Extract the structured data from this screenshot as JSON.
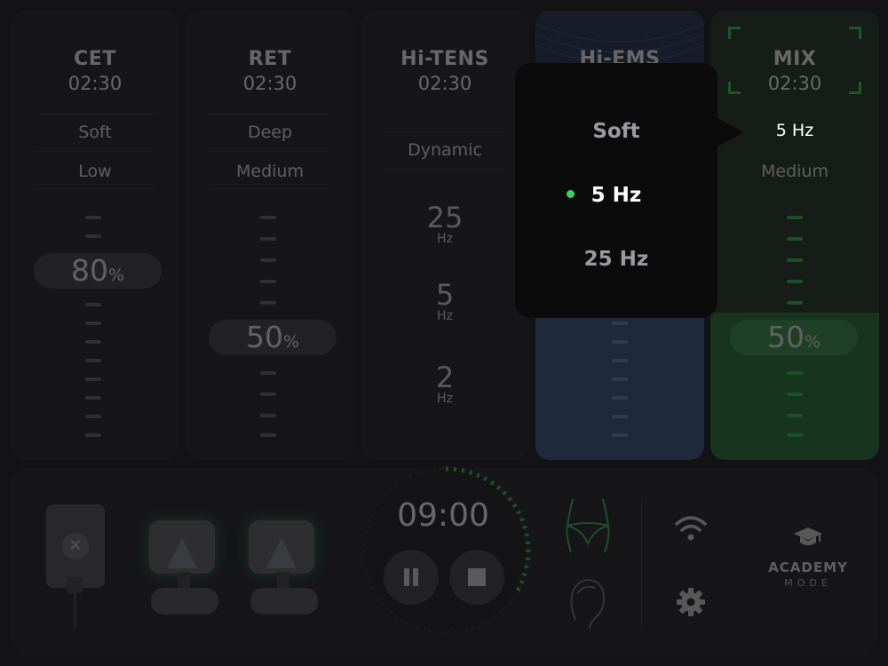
{
  "columns": [
    {
      "id": "cet",
      "title": "CET",
      "time": "02:30",
      "opt1": "Soft",
      "opt2": "Low",
      "intensity": "80",
      "unit": "%"
    },
    {
      "id": "ret",
      "title": "RET",
      "time": "02:30",
      "opt1": "Deep",
      "opt2": "Medium",
      "intensity": "50",
      "unit": "%"
    },
    {
      "id": "hitens",
      "title": "Hi-TENS",
      "time": "02:30",
      "opt1": "Dynamic",
      "freqs": [
        {
          "value": "25",
          "unit": "Hz"
        },
        {
          "value": "5",
          "unit": "Hz"
        },
        {
          "value": "2",
          "unit": "Hz"
        }
      ]
    },
    {
      "id": "hiems",
      "title": "Hi-EMS"
    },
    {
      "id": "mix",
      "title": "MIX",
      "time": "02:30",
      "opt1": "5 Hz",
      "opt2": "Medium",
      "intensity": "50",
      "unit": "%"
    }
  ],
  "popup": {
    "options": [
      "Soft",
      "5 Hz",
      "25 Hz"
    ],
    "selected_index": 1
  },
  "timer": {
    "value": "09:00"
  },
  "academy": {
    "line1": "ACADEMY",
    "line2": "MODE"
  },
  "colors": {
    "accent": "#3ad45c",
    "ems_blue": "#3f5c8a",
    "mix_green": "#2d7a3e"
  },
  "icons": [
    "close-icon",
    "pause-icon",
    "stop-icon",
    "body-torso-icon",
    "head-face-icon",
    "wifi-icon",
    "gear-icon",
    "graduation-cap-icon"
  ]
}
